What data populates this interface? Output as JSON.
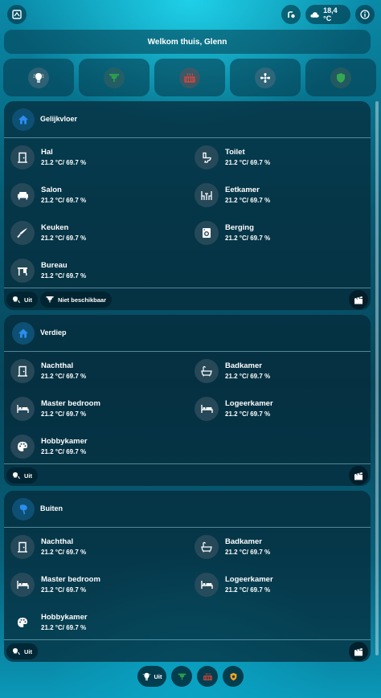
{
  "topbar": {
    "weather_temp": "18,4 °C"
  },
  "welcome": {
    "text": "Welkom thuis, Glenn"
  },
  "categories": [
    {
      "icon": "lightbulb-icon",
      "color": "#ffffff"
    },
    {
      "icon": "ceiling-light-icon",
      "color": "#2e9e4a"
    },
    {
      "icon": "radiator-icon",
      "color": "#e0463a"
    },
    {
      "icon": "fan-icon",
      "color": "#ffffff"
    },
    {
      "icon": "shield-icon",
      "color": "#33a852"
    }
  ],
  "areas": [
    {
      "title": "Gelijkvloer",
      "rooms": [
        {
          "name": "Hal",
          "status": "21.2 °C/ 69.7 %",
          "icon": "door-icon"
        },
        {
          "name": "Toilet",
          "status": "21.2 °C/ 69.7 %",
          "icon": "toilet-icon"
        },
        {
          "name": "Salon",
          "status": "21.2 °C/ 69.7 %",
          "icon": "sofa-icon"
        },
        {
          "name": "Eetkamer",
          "status": "21.2 °C/ 69.7 %",
          "icon": "dining-table-icon"
        },
        {
          "name": "Keuken",
          "status": "21.2 °C/ 69.7 %",
          "icon": "knife-icon"
        },
        {
          "name": "Berging",
          "status": "21.2 °C/ 69.7 %",
          "icon": "washing-machine-icon"
        },
        {
          "name": "Bureau",
          "status": "21.2 °C/ 69.7 %",
          "icon": "desk-icon"
        }
      ],
      "footer": {
        "lights": "Uit",
        "ceiling": "Niet beschikbaar"
      }
    },
    {
      "title": "Verdiep",
      "rooms": [
        {
          "name": "Nachthal",
          "status": "21.2 °C/ 69.7 %",
          "icon": "door-icon"
        },
        {
          "name": "Badkamer",
          "status": "21.2 °C/ 69.7 %",
          "icon": "bathtub-icon"
        },
        {
          "name": "Master bedroom",
          "status": "21.2 °C/ 69.7 %",
          "icon": "bed-icon"
        },
        {
          "name": "Logeerkamer",
          "status": "21.2 °C/ 69.7 %",
          "icon": "bed-icon"
        },
        {
          "name": "Hobbykamer",
          "status": "21.2 °C/ 69.7 %",
          "icon": "palette-icon"
        }
      ],
      "footer": {
        "lights": "Uit"
      }
    },
    {
      "title": "Buiten",
      "rooms": [
        {
          "name": "Nachthal",
          "status": "21.2 °C/ 69.7 %",
          "icon": "door-icon"
        },
        {
          "name": "Badkamer",
          "status": "21.2 °C/ 69.7 %",
          "icon": "bathtub-icon"
        },
        {
          "name": "Master bedroom",
          "status": "21.2 °C/ 69.7 %",
          "icon": "bed-icon"
        },
        {
          "name": "Logeerkamer",
          "status": "21.2 °C/ 69.7 %",
          "icon": "bed-icon"
        },
        {
          "name": "Hobbykamer",
          "status": "21.2 °C/ 69.7 %",
          "icon": "palette-icon"
        }
      ],
      "footer": {
        "lights": "Uit"
      }
    }
  ],
  "bottombar": {
    "lights": "Uit"
  }
}
